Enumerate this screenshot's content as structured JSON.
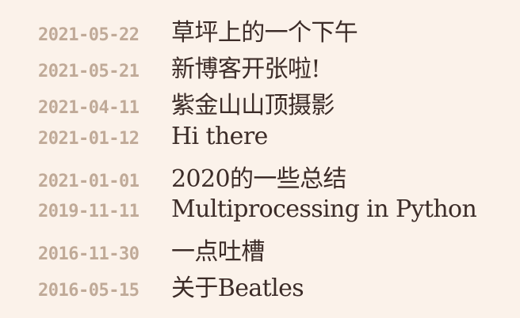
{
  "posts": [
    {
      "date": "2021-05-22",
      "title": "草坪上的一个下午"
    },
    {
      "date": "2021-05-21",
      "title": "新博客开张啦!"
    },
    {
      "date": "2021-04-11",
      "title": "紫金山山顶摄影"
    },
    {
      "date": "2021-01-12",
      "title": "Hi there"
    },
    {
      "date": "2021-01-01",
      "title": "2020的一些总结"
    },
    {
      "date": "2019-11-11",
      "title": "Multiprocessing in Python"
    },
    {
      "date": "2016-11-30",
      "title": "一点吐槽"
    },
    {
      "date": "2016-05-15",
      "title": "关于Beatles"
    }
  ]
}
